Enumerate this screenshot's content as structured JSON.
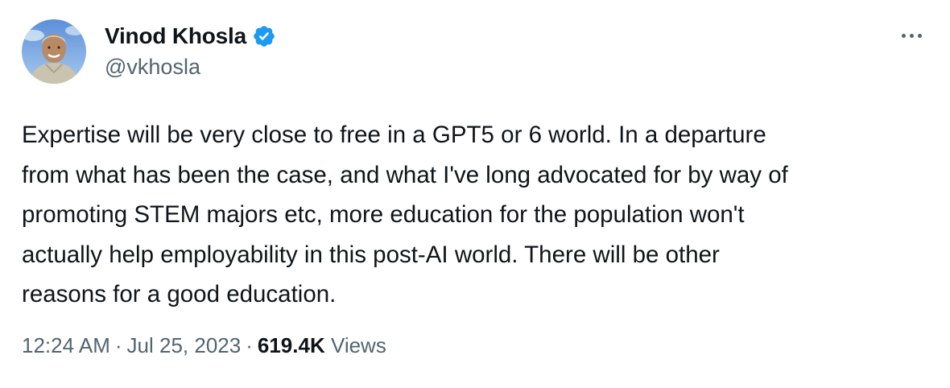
{
  "author": {
    "display_name": "Vinod Khosla",
    "handle": "@vkhosla",
    "verified": true,
    "verified_color": "#1d9bf0"
  },
  "tweet": {
    "text_lines": [
      "Expertise will be very close to free in a GPT5 or 6 world. In a departure",
      "from what has been the case, and what I've long advocated for by way of",
      "promoting STEM majors etc, more education for the population won't",
      "actually help employability in this post-AI world. There will be other",
      "reasons for a good education."
    ],
    "time": "12:24 AM",
    "date": "Jul 25, 2023",
    "separator": "·",
    "views_count": "619.4K",
    "views_label": "Views"
  },
  "icons": {
    "more": "more-options-icon",
    "verified": "verified-badge-icon"
  },
  "colors": {
    "text_primary": "#0f1419",
    "text_secondary": "#536471",
    "background": "#ffffff"
  }
}
